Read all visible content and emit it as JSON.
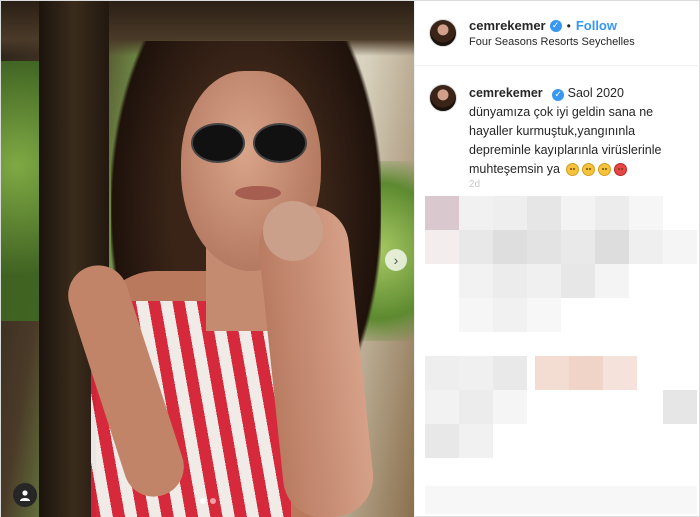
{
  "post": {
    "username": "cemrekemer",
    "verified_glyph": "✓",
    "separator": "•",
    "follow_label": "Follow",
    "location": "Four Seasons Resorts Seychelles",
    "caption": "Saol 2020 dünyamıza çok iyi geldin sana ne hayaller kurmuştuk,yangınınla depreminle kayıplarınla virüslerinle muhteşemsin ya",
    "caption_emojis": [
      "persevering-face",
      "tired-face",
      "disappointed-face",
      "pouting-face"
    ],
    "time_ago": "2d",
    "image_count": 2,
    "active_image_index": 0
  },
  "icons": {
    "next": "chevron-right-icon",
    "tag": "user-tag-icon",
    "verified": "verified-badge-icon"
  },
  "colors": {
    "link_blue": "#3897f0",
    "text": "#262626",
    "border": "#dbdbdb"
  }
}
